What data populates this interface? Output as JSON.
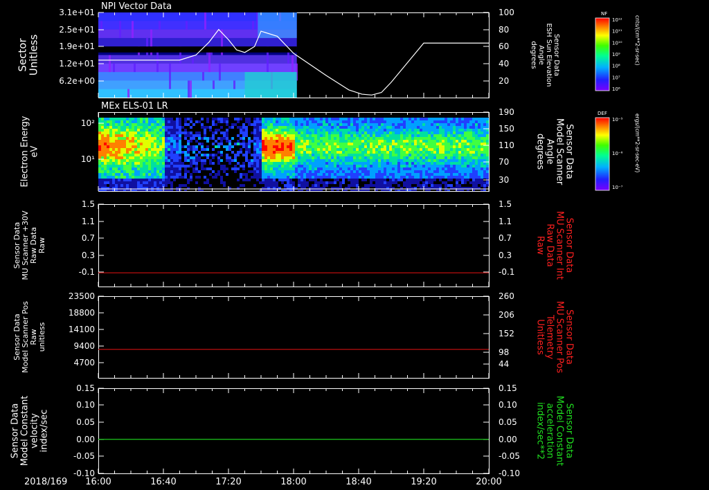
{
  "colors": {
    "background": "#000000",
    "axis": "#ffffff",
    "red_trace": "#d01010",
    "green_trace": "#20e020",
    "right_red_label": "#ff2020",
    "right_green_label": "#20e020"
  },
  "chart_data": [
    {
      "id": "panel1",
      "type": "heatmap",
      "title": "NPI Vector Data",
      "ylabel": [
        "Sector",
        "Unitless"
      ],
      "yticks": [
        "3.1e+01",
        "2.5e+01",
        "1.9e+01",
        "1.2e+01",
        "6.2e+00"
      ],
      "ylim": [
        0,
        31
      ],
      "right_ylabel": [
        "Sensor Data",
        "ESH Sun Elevation",
        "Angle",
        "degrees"
      ],
      "right_yticks": [
        "100",
        "80",
        "60",
        "40",
        "20"
      ],
      "right_ylim": [
        0,
        100
      ],
      "data_extent_x": [
        "16:00",
        "18:02"
      ],
      "line": {
        "name": "ESH Sun Elevation Angle",
        "x": [
          "16:00",
          "16:50",
          "17:00",
          "17:08",
          "17:14",
          "17:20",
          "17:25",
          "17:30",
          "17:36",
          "17:40",
          "17:50",
          "18:00",
          "18:20",
          "18:34",
          "18:42",
          "18:48",
          "18:54",
          "19:00",
          "19:20",
          "19:40",
          "20:00"
        ],
        "y": [
          44,
          44,
          50,
          65,
          80,
          68,
          56,
          53,
          60,
          78,
          72,
          52,
          26,
          9,
          4,
          3,
          6,
          18,
          64,
          64,
          64
        ]
      },
      "colorbar": {
        "label": "NF",
        "unit": "cnts/(cm**2-sr-sec)",
        "ticks": [
          "10¹²",
          "10¹¹",
          "10¹⁰",
          "10⁹",
          "10⁸",
          "10⁷",
          "10⁶"
        ]
      }
    },
    {
      "id": "panel2",
      "type": "heatmap",
      "title": "MEx ELS-01 LR",
      "ylabel": [
        "Electron Energy",
        "eV"
      ],
      "yticks": [
        "10²",
        "10¹"
      ],
      "right_ylabel": [
        "Sensor Data",
        "Model Scanner",
        "Angle",
        "degrees"
      ],
      "right_yticks": [
        "190",
        "150",
        "110",
        "70",
        "30"
      ],
      "right_ylim": [
        0,
        190
      ],
      "line": {
        "name": "Model Scanner Angle",
        "y_constant": 0
      },
      "colorbar": {
        "label": "DEF",
        "unit": "ergs/(cm**2-sr-sec-eV)",
        "ticks": [
          "10⁻⁵",
          "10⁻⁶",
          "10⁻⁷"
        ]
      }
    },
    {
      "id": "panel3",
      "type": "line",
      "ylabel": [
        "Sensor Data",
        "MU Scanner +30V",
        "Raw Data",
        "Raw"
      ],
      "yticks": [
        "1.5",
        "1.1",
        "0.7",
        "0.3",
        "-0.1"
      ],
      "ylim": [
        -0.3,
        1.5
      ],
      "right_ylabel": [
        "Sensor Data",
        "MU Scanner Int",
        "Raw Data",
        "Raw"
      ],
      "right_yticks": [
        "1.5",
        "1.1",
        "0.7",
        "0.3",
        "-0.1"
      ],
      "right_ylim": [
        -0.3,
        1.5
      ],
      "series": [
        {
          "x": [
            "16:00",
            "20:00"
          ],
          "y": [
            0,
            0
          ],
          "color": "#d01010"
        }
      ]
    },
    {
      "id": "panel4",
      "type": "line",
      "ylabel": [
        "Sensor Data",
        "Model Scanner Pos",
        "Raw",
        "unitless"
      ],
      "yticks": [
        "23500",
        "18800",
        "14100",
        "9400",
        "4700"
      ],
      "ylim": [
        0,
        23500
      ],
      "right_ylabel": [
        "Sensor Data",
        "MU Scanner Pos",
        "Telemetry",
        "Unitless"
      ],
      "right_yticks": [
        "260",
        "206",
        "152",
        "98",
        "44"
      ],
      "right_ylim": [
        -10,
        260
      ],
      "series": [
        {
          "x": [
            "16:00",
            "20:00"
          ],
          "y": [
            8200,
            8200
          ],
          "color": "#d01010"
        }
      ]
    },
    {
      "id": "panel5",
      "type": "line",
      "ylabel": [
        "Sensor Data",
        "Model Constant",
        "velocity",
        "index/sec"
      ],
      "yticks": [
        "0.15",
        "0.10",
        "0.05",
        "0.00",
        "-0.05",
        "-0.10"
      ],
      "ylim": [
        -0.1,
        0.15
      ],
      "right_ylabel": [
        "Sensor Data",
        "Model Constant",
        "acceleration",
        "index/sec**2"
      ],
      "right_yticks": [
        "0.15",
        "0.10",
        "0.05",
        "0.00",
        "-0.05",
        "-0.10"
      ],
      "right_ylim": [
        -0.1,
        0.15
      ],
      "series": [
        {
          "x": [
            "16:00",
            "20:00"
          ],
          "y": [
            0,
            0
          ],
          "color": "#20e020"
        }
      ]
    }
  ],
  "xaxis": {
    "date": "2018/169",
    "ticks": [
      "16:00",
      "16:40",
      "17:20",
      "18:00",
      "18:40",
      "19:20",
      "20:00"
    ],
    "range": [
      "16:00",
      "20:00"
    ]
  }
}
